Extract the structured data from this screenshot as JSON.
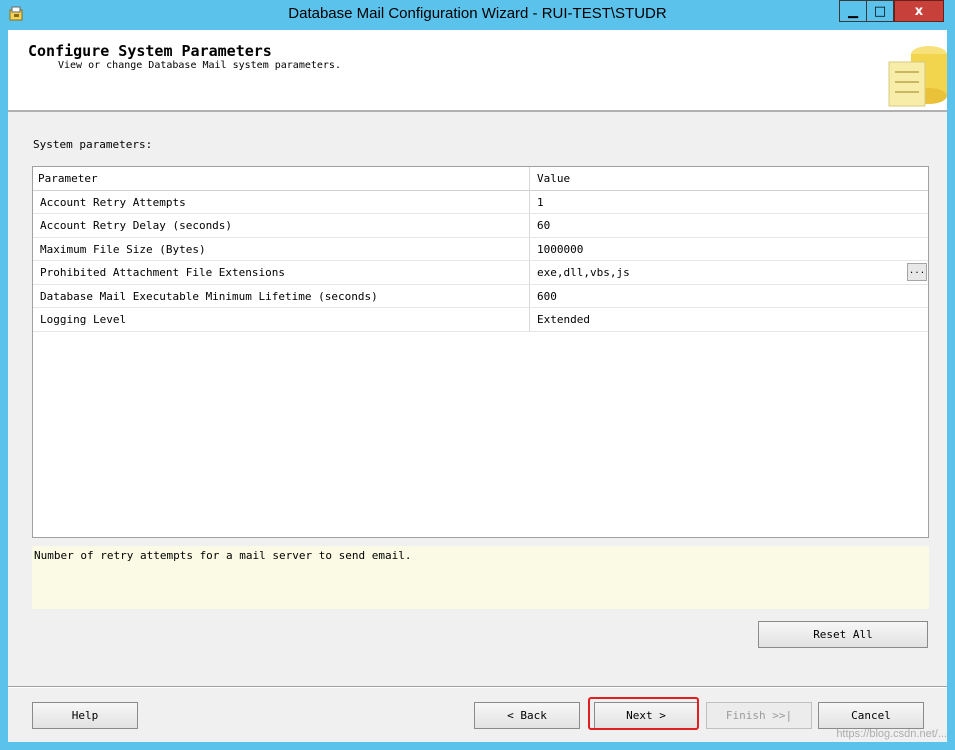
{
  "window": {
    "title": "Database Mail Configuration Wizard - RUI-TEST\\STUDR",
    "minimize_glyph": "▁",
    "maximize_glyph": "□",
    "close_glyph": "x"
  },
  "header": {
    "title": "Configure System Parameters",
    "subtitle": "View or change Database Mail system parameters."
  },
  "system_parameters_label": "System parameters:",
  "grid": {
    "columns": [
      "Parameter",
      "Value"
    ],
    "rows": [
      {
        "parameter": "Account Retry Attempts",
        "value": "1"
      },
      {
        "parameter": "Account Retry Delay (seconds)",
        "value": "60"
      },
      {
        "parameter": "Maximum File Size (Bytes)",
        "value": "1000000"
      },
      {
        "parameter": "Prohibited Attachment File Extensions",
        "value": "exe,dll,vbs,js",
        "ellipsis": "..."
      },
      {
        "parameter": "Database Mail Executable Minimum Lifetime (seconds)",
        "value": "600"
      },
      {
        "parameter": "Logging Level",
        "value": "Extended"
      }
    ]
  },
  "description": "Number of retry attempts for a mail server to send email.",
  "buttons": {
    "reset_all": "Reset All",
    "help": "Help",
    "back": "< Back",
    "next": "Next >",
    "finish": "Finish >>|",
    "cancel": "Cancel"
  },
  "watermark": "https://blog.csdn.net/...",
  "colors": {
    "titlebar": "#5bc2eb",
    "close_button": "#c7413a",
    "description_bg": "#fbfbe5",
    "highlight": "#e02020"
  },
  "icons": [
    "app-icon",
    "wizard-header-art",
    "ellipsis-icon"
  ]
}
